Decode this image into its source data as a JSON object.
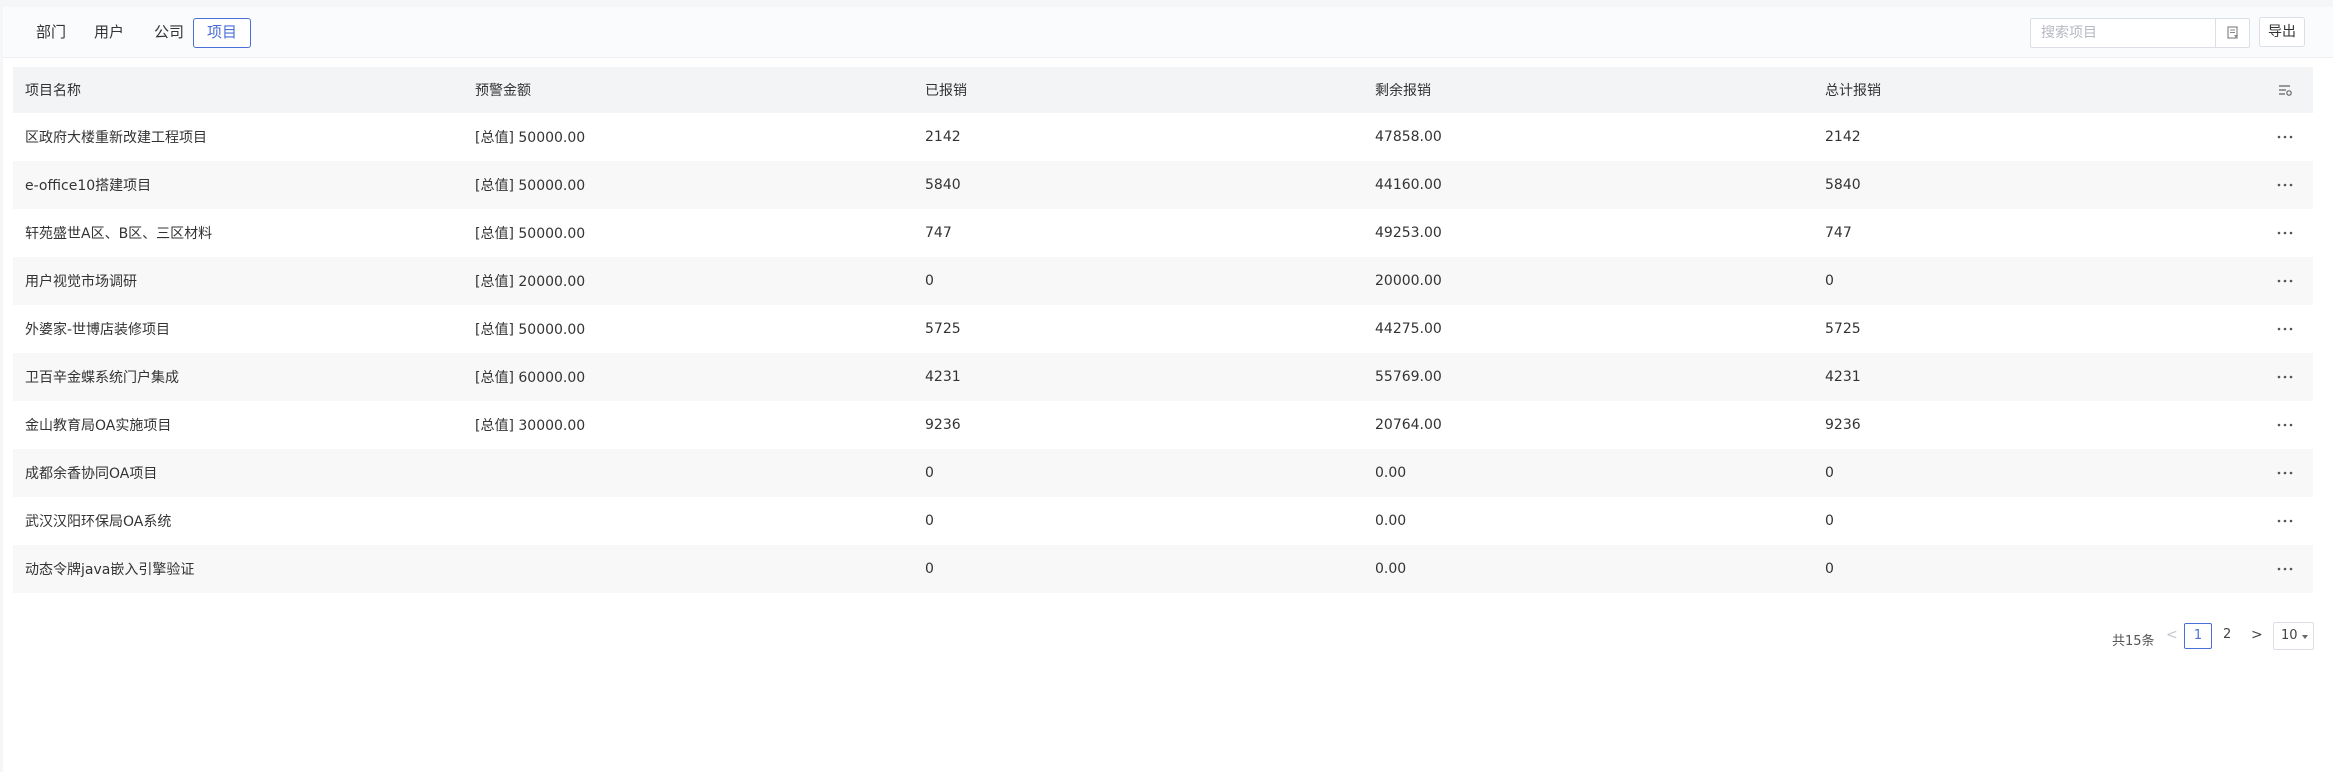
{
  "tabs": [
    {
      "label": "部门",
      "active": false
    },
    {
      "label": "用户",
      "active": false
    },
    {
      "label": "公司",
      "active": false
    },
    {
      "label": "项目",
      "active": true
    }
  ],
  "search": {
    "placeholder": "搜索项目",
    "value": ""
  },
  "export_label": "导出",
  "table": {
    "headers": [
      "项目名称",
      "预警金额",
      "已报销",
      "剩余报销",
      "总计报销"
    ],
    "rows": [
      [
        "区政府大楼重新改建工程项目",
        "[总值] 50000.00",
        "2142",
        "47858.00",
        "2142"
      ],
      [
        "e-office10搭建项目",
        "[总值] 50000.00",
        "5840",
        "44160.00",
        "5840"
      ],
      [
        "轩苑盛世A区、B区、三区材料",
        "[总值] 50000.00",
        "747",
        "49253.00",
        "747"
      ],
      [
        "用户视觉市场调研",
        "[总值] 20000.00",
        "0",
        "20000.00",
        "0"
      ],
      [
        "外婆家-世博店装修项目",
        "[总值] 50000.00",
        "5725",
        "44275.00",
        "5725"
      ],
      [
        "卫百辛金蝶系统门户集成",
        "[总值] 60000.00",
        "4231",
        "55769.00",
        "4231"
      ],
      [
        "金山教育局OA实施项目",
        "[总值] 30000.00",
        "9236",
        "20764.00",
        "9236"
      ],
      [
        "成都余香协同OA项目",
        "",
        "0",
        "0.00",
        "0"
      ],
      [
        "武汉汉阳环保局OA系统",
        "",
        "0",
        "0.00",
        "0"
      ],
      [
        "动态令牌java嵌入引擎验证",
        "",
        "0",
        "0.00",
        "0"
      ]
    ]
  },
  "pagination": {
    "total_label": "共15条",
    "prev": "<",
    "pages": [
      "1",
      "2"
    ],
    "current": "1",
    "next": ">",
    "page_size": "10"
  },
  "colors": {
    "accent": "#4a6fd6"
  }
}
